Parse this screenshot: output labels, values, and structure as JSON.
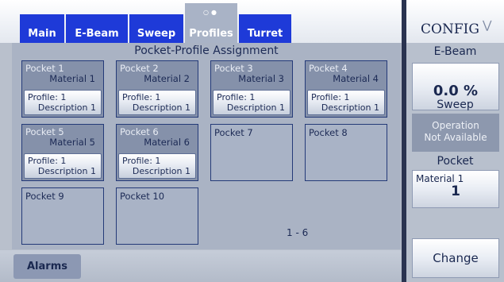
{
  "tabs": [
    {
      "label": "Main"
    },
    {
      "label": "E-Beam"
    },
    {
      "label": "Sweep"
    },
    {
      "label": "Profiles",
      "active": true
    },
    {
      "label": "Turret"
    }
  ],
  "main": {
    "title": "Pocket-Profile Assignment",
    "pockets": [
      {
        "name": "Pocket 1",
        "material": "Material 1",
        "profile": "Profile: 1",
        "description": "Description 1"
      },
      {
        "name": "Pocket 2",
        "material": "Material 2",
        "profile": "Profile: 1",
        "description": "Description 1"
      },
      {
        "name": "Pocket 3",
        "material": "Material 3",
        "profile": "Profile: 1",
        "description": "Description 1"
      },
      {
        "name": "Pocket 4",
        "material": "Material 4",
        "profile": "Profile: 1",
        "description": "Description 1"
      },
      {
        "name": "Pocket 5",
        "material": "Material 5",
        "profile": "Profile: 1",
        "description": "Description 1"
      },
      {
        "name": "Pocket 6",
        "material": "Material 6",
        "profile": "Profile: 1",
        "description": "Description 1"
      },
      {
        "name": "Pocket 7"
      },
      {
        "name": "Pocket 8"
      },
      {
        "name": "Pocket 9"
      },
      {
        "name": "Pocket 10"
      }
    ],
    "page_indicator": "1 - 6"
  },
  "bottom": {
    "alarms_label": "Alarms"
  },
  "right": {
    "config_title": "CONFIG",
    "ebeam_label": "E-Beam",
    "ebeam_value": "0.0 %",
    "sweep_label": "Sweep",
    "sweep_status_line1": "Operation",
    "sweep_status_line2": "Not Available",
    "pocket_label": "Pocket",
    "pocket_material": "Material 1",
    "pocket_number": "1",
    "change_label": "Change"
  },
  "icons": {
    "config_chevron": "chevron-down-icon",
    "tab_dots": "page-dots-icon"
  },
  "colors": {
    "tab_blue": "#1e3ad8",
    "panel_gray": "#aab3c4",
    "filled_pocket": "#8591aa",
    "text_navy": "#1a2850"
  }
}
